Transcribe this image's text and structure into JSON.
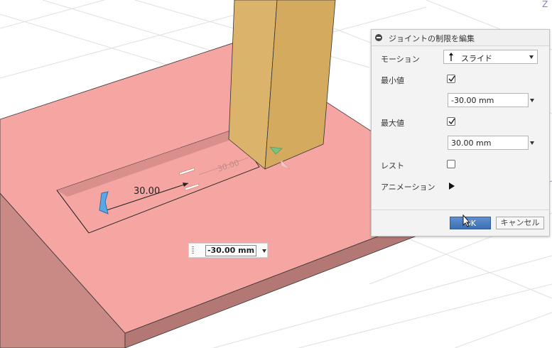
{
  "viewport": {
    "dimension_main": "30.00",
    "dimension_faint": "30.00",
    "axis_label": "Z",
    "floating_input_value": "-30.00 mm"
  },
  "panel": {
    "title": "ジョイントの制限を編集",
    "motion_label": "モーション",
    "motion_value": "スライド",
    "min_label": "最小値",
    "min_checked": true,
    "min_value": "-30.00 mm",
    "max_label": "最大値",
    "max_checked": true,
    "max_value": "30.00 mm",
    "rest_label": "レスト",
    "rest_checked": false,
    "animation_label": "アニメーション",
    "ok_label": "OK",
    "cancel_label": "キャンセル"
  }
}
